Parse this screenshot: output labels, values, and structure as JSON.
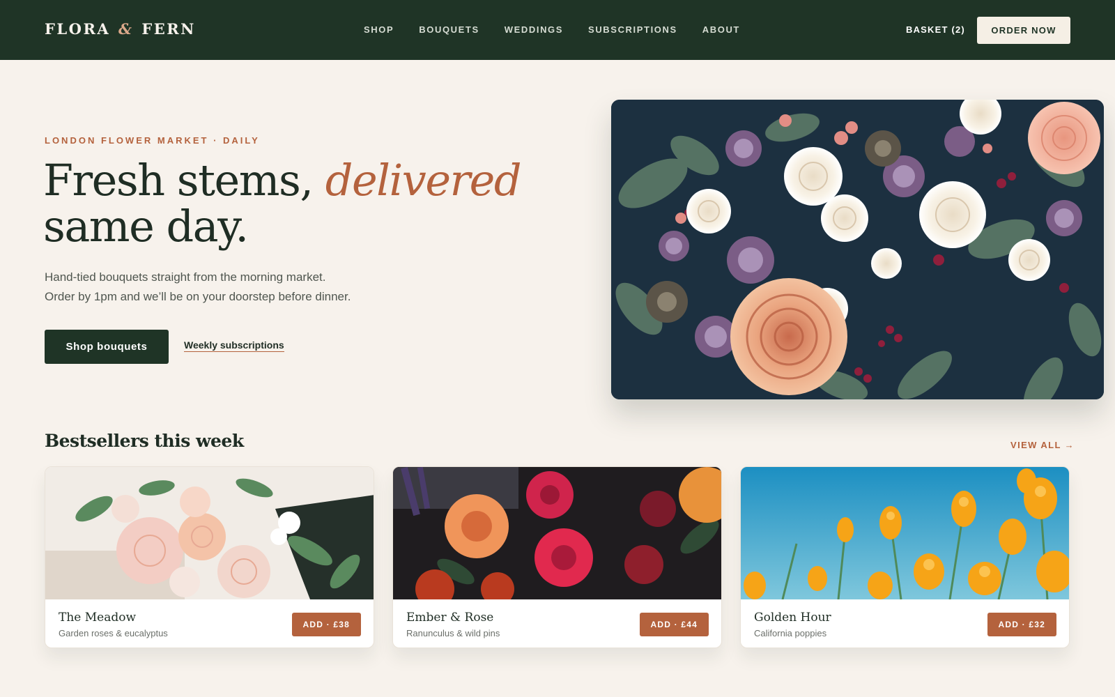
{
  "brand": {
    "name_left": "FLORA",
    "ampersand": "&",
    "name_right": "FERN"
  },
  "nav": {
    "links": [
      "SHOP",
      "BOUQUETS",
      "WEDDINGS",
      "SUBSCRIPTIONS",
      "ABOUT"
    ],
    "basket": "BASKET (2)",
    "order_now": "ORDER NOW"
  },
  "hero": {
    "eyebrow": "LONDON FLOWER MARKET · DAILY",
    "headline_before": "Fresh stems, ",
    "headline_emphasis": "delivered",
    "headline_after": " same day.",
    "subtext_line1": "Hand-tied bouquets straight from the morning market.",
    "subtext_line2": "Order by 1pm and we’ll be on your doorstep before dinner.",
    "primary_cta": "Shop bouquets",
    "secondary_cta": "Weekly subscriptions"
  },
  "bestsellers": {
    "title": "Bestsellers this week",
    "view_all": "VIEW ALL →",
    "products": [
      {
        "name": "The Meadow",
        "description": "Garden roses & eucalyptus",
        "add_label": "ADD · £38"
      },
      {
        "name": "Ember & Rose",
        "description": "Ranunculus & wild pins",
        "add_label": "ADD · £44"
      },
      {
        "name": "Golden Hour",
        "description": "California poppies",
        "add_label": "ADD · £32"
      }
    ]
  },
  "colors": {
    "nav_bg": "#1f3426",
    "page_bg": "#f7f2ec",
    "accent": "#b4623d",
    "text_dark": "#1f2d24"
  }
}
